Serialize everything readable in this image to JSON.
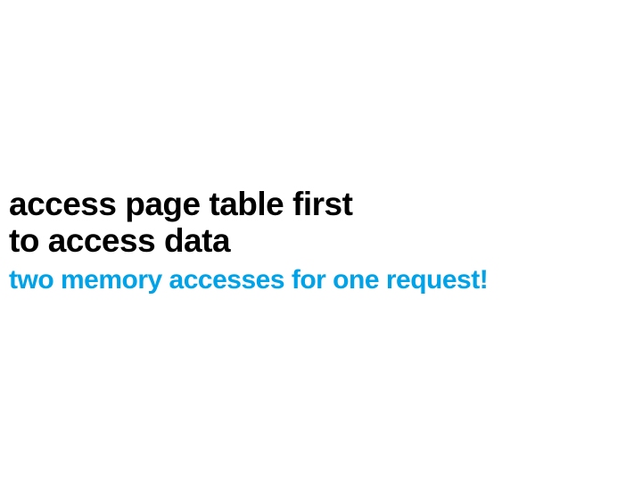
{
  "slide": {
    "line1": "access page table first",
    "line2": "to access data",
    "emphasis": "two memory accesses for one request!"
  }
}
